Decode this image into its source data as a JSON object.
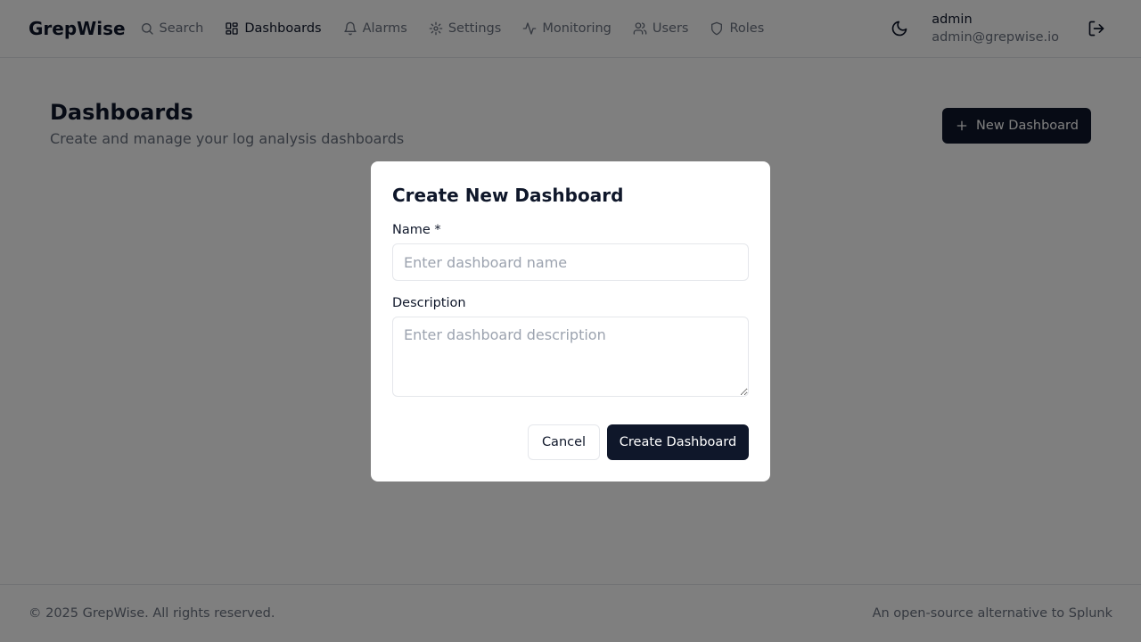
{
  "header": {
    "brand": "GrepWise",
    "nav": [
      {
        "label": "Search",
        "icon": "search-icon"
      },
      {
        "label": "Dashboards",
        "icon": "dashboard-icon",
        "active": true
      },
      {
        "label": "Alarms",
        "icon": "bell-icon"
      },
      {
        "label": "Settings",
        "icon": "gear-icon"
      },
      {
        "label": "Monitoring",
        "icon": "activity-icon"
      },
      {
        "label": "Users",
        "icon": "users-icon"
      },
      {
        "label": "Roles",
        "icon": "shield-icon"
      }
    ],
    "user": {
      "name": "admin",
      "email": "admin@grepwise.io"
    }
  },
  "main": {
    "title": "Dashboards",
    "subtitle": "Create and manage your log analysis dashboards",
    "new_button": "New Dashboard"
  },
  "modal": {
    "title": "Create New Dashboard",
    "name_label": "Name *",
    "name_placeholder": "Enter dashboard name",
    "name_value": "",
    "description_label": "Description",
    "description_placeholder": "Enter dashboard description",
    "description_value": "",
    "cancel_label": "Cancel",
    "create_label": "Create Dashboard"
  },
  "footer": {
    "copyright": "© 2025 GrepWise. All rights reserved.",
    "tagline": "An open-source alternative to Splunk"
  },
  "colors": {
    "primary": "#0f172a",
    "muted": "#6b7280",
    "border": "#e5e7eb",
    "overlay": "rgba(0,0,0,0.5)"
  }
}
